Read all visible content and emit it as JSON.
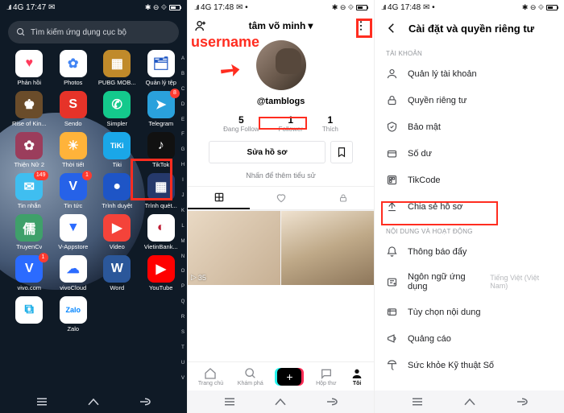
{
  "status": {
    "signal": "..ıll",
    "net": "4G",
    "time": "17:47",
    "time2": "17:48",
    "icons_right": "✱ ⊖ ⟐"
  },
  "screen1": {
    "search_placeholder": "Tìm kiếm ứng dụng cục bộ",
    "apps": [
      {
        "label": "Phản hồi",
        "color": "#fff",
        "fg": "#ff3b5c",
        "icon": "♥"
      },
      {
        "label": "Photos",
        "color": "#fff",
        "fg": "#4285f4",
        "icon": "✿"
      },
      {
        "label": "PUBG MOB...",
        "color": "#c08a2a",
        "fg": "#fff",
        "icon": "▦"
      },
      {
        "label": "Quản lý tệp",
        "color": "#fff",
        "fg": "#1f57c4",
        "icon": "🗂"
      },
      {
        "label": "Rise of Kin...",
        "color": "#6a4c2a",
        "fg": "#fff",
        "icon": "♚"
      },
      {
        "label": "Sendo",
        "color": "#e63329",
        "fg": "#fff",
        "icon": "S"
      },
      {
        "label": "Simpler",
        "color": "#14c98c",
        "fg": "#fff",
        "icon": "✆"
      },
      {
        "label": "Telegram",
        "color": "#2aa1dc",
        "fg": "#fff",
        "icon": "➤",
        "badge": "8"
      },
      {
        "label": "Thiện Nữ 2",
        "color": "#9b3d5c",
        "fg": "#fff",
        "icon": "✿"
      },
      {
        "label": "Thời tiết",
        "color": "#ffb33a",
        "fg": "#fff",
        "icon": "☀"
      },
      {
        "label": "Tiki",
        "color": "#1aa7e8",
        "fg": "#fff",
        "icon": "TiKi"
      },
      {
        "label": "TikTok",
        "color": "#111",
        "fg": "#fff",
        "icon": "♪"
      },
      {
        "label": "Tin nhắn",
        "color": "#3fbef0",
        "fg": "#fff",
        "icon": "✉",
        "badge": "149"
      },
      {
        "label": "Tin tức",
        "color": "#2662e8",
        "fg": "#fff",
        "icon": "V",
        "badge": "1"
      },
      {
        "label": "Trình duyệt",
        "color": "#1e55c6",
        "fg": "#fff",
        "icon": "●"
      },
      {
        "label": "Trình quét...",
        "color": "#25396b",
        "fg": "#fff",
        "icon": "▦"
      },
      {
        "label": "TruyenCv",
        "color": "#3fa06a",
        "fg": "#fff",
        "icon": "儒"
      },
      {
        "label": "V-Appstore",
        "color": "#fff",
        "fg": "#2b6bff",
        "icon": "▼"
      },
      {
        "label": "Video",
        "color": "#f4433a",
        "fg": "#fff",
        "icon": "▶"
      },
      {
        "label": "VietinBank...",
        "color": "#fff",
        "fg": "#c01c34",
        "icon": "◐"
      },
      {
        "label": "vivo.com",
        "color": "#2b6bff",
        "fg": "#fff",
        "icon": "V",
        "badge": "1"
      },
      {
        "label": "vivoCloud",
        "color": "#fff",
        "fg": "#2b6bff",
        "icon": "☁"
      },
      {
        "label": "Word",
        "color": "#2b579a",
        "fg": "#fff",
        "icon": "W"
      },
      {
        "label": "YouTube",
        "color": "#ff0000",
        "fg": "#fff",
        "icon": "▶"
      },
      {
        "label": "",
        "color": "#fff",
        "fg": "#0aa8e6",
        "icon": "⧉"
      },
      {
        "label": "Zalo",
        "color": "#fff",
        "fg": "#0084ff",
        "icon": "Zalo"
      }
    ],
    "az": [
      "A",
      "B",
      "C",
      "D",
      "E",
      "F",
      "G",
      "H",
      "I",
      "J",
      "K",
      "L",
      "M",
      "N",
      "O",
      "P",
      "Q",
      "R",
      "S",
      "T",
      "U",
      "V"
    ]
  },
  "screen2": {
    "title": "tâm võ minh",
    "annotation": "username",
    "handle": "@tamblogs",
    "stats": [
      {
        "n": "5",
        "l": "Đang Follow"
      },
      {
        "n": "1",
        "l": "Follower"
      },
      {
        "n": "1",
        "l": "Thích"
      }
    ],
    "edit_label": "Sửa hồ sơ",
    "bio_hint": "Nhấn để thêm tiểu sử",
    "views": "35",
    "bottom": [
      {
        "l": "Trang chủ"
      },
      {
        "l": "Khám phá"
      },
      {
        "l": ""
      },
      {
        "l": "Hộp thư"
      },
      {
        "l": "Tôi"
      }
    ]
  },
  "screen3": {
    "title": "Cài đặt và quyền riêng tư",
    "section1": "TÀI KHOẢN",
    "items_acct": [
      {
        "l": "Quản lý tài khoản"
      },
      {
        "l": "Quyền riêng tư"
      },
      {
        "l": "Bảo mật"
      },
      {
        "l": "Số dư"
      },
      {
        "l": "TikCode"
      },
      {
        "l": "Chia sẻ hồ sơ"
      }
    ],
    "section2": "NỘI DUNG VÀ HOẠT ĐỘNG",
    "items_act": [
      {
        "l": "Thông báo đẩy"
      },
      {
        "l": "Ngôn ngữ ứng dụng",
        "extra": "Tiếng Việt (Việt Nam)"
      },
      {
        "l": "Tùy chọn nội dung"
      },
      {
        "l": "Quảng cáo"
      },
      {
        "l": "Sức khỏe Kỹ thuật Số"
      }
    ]
  }
}
